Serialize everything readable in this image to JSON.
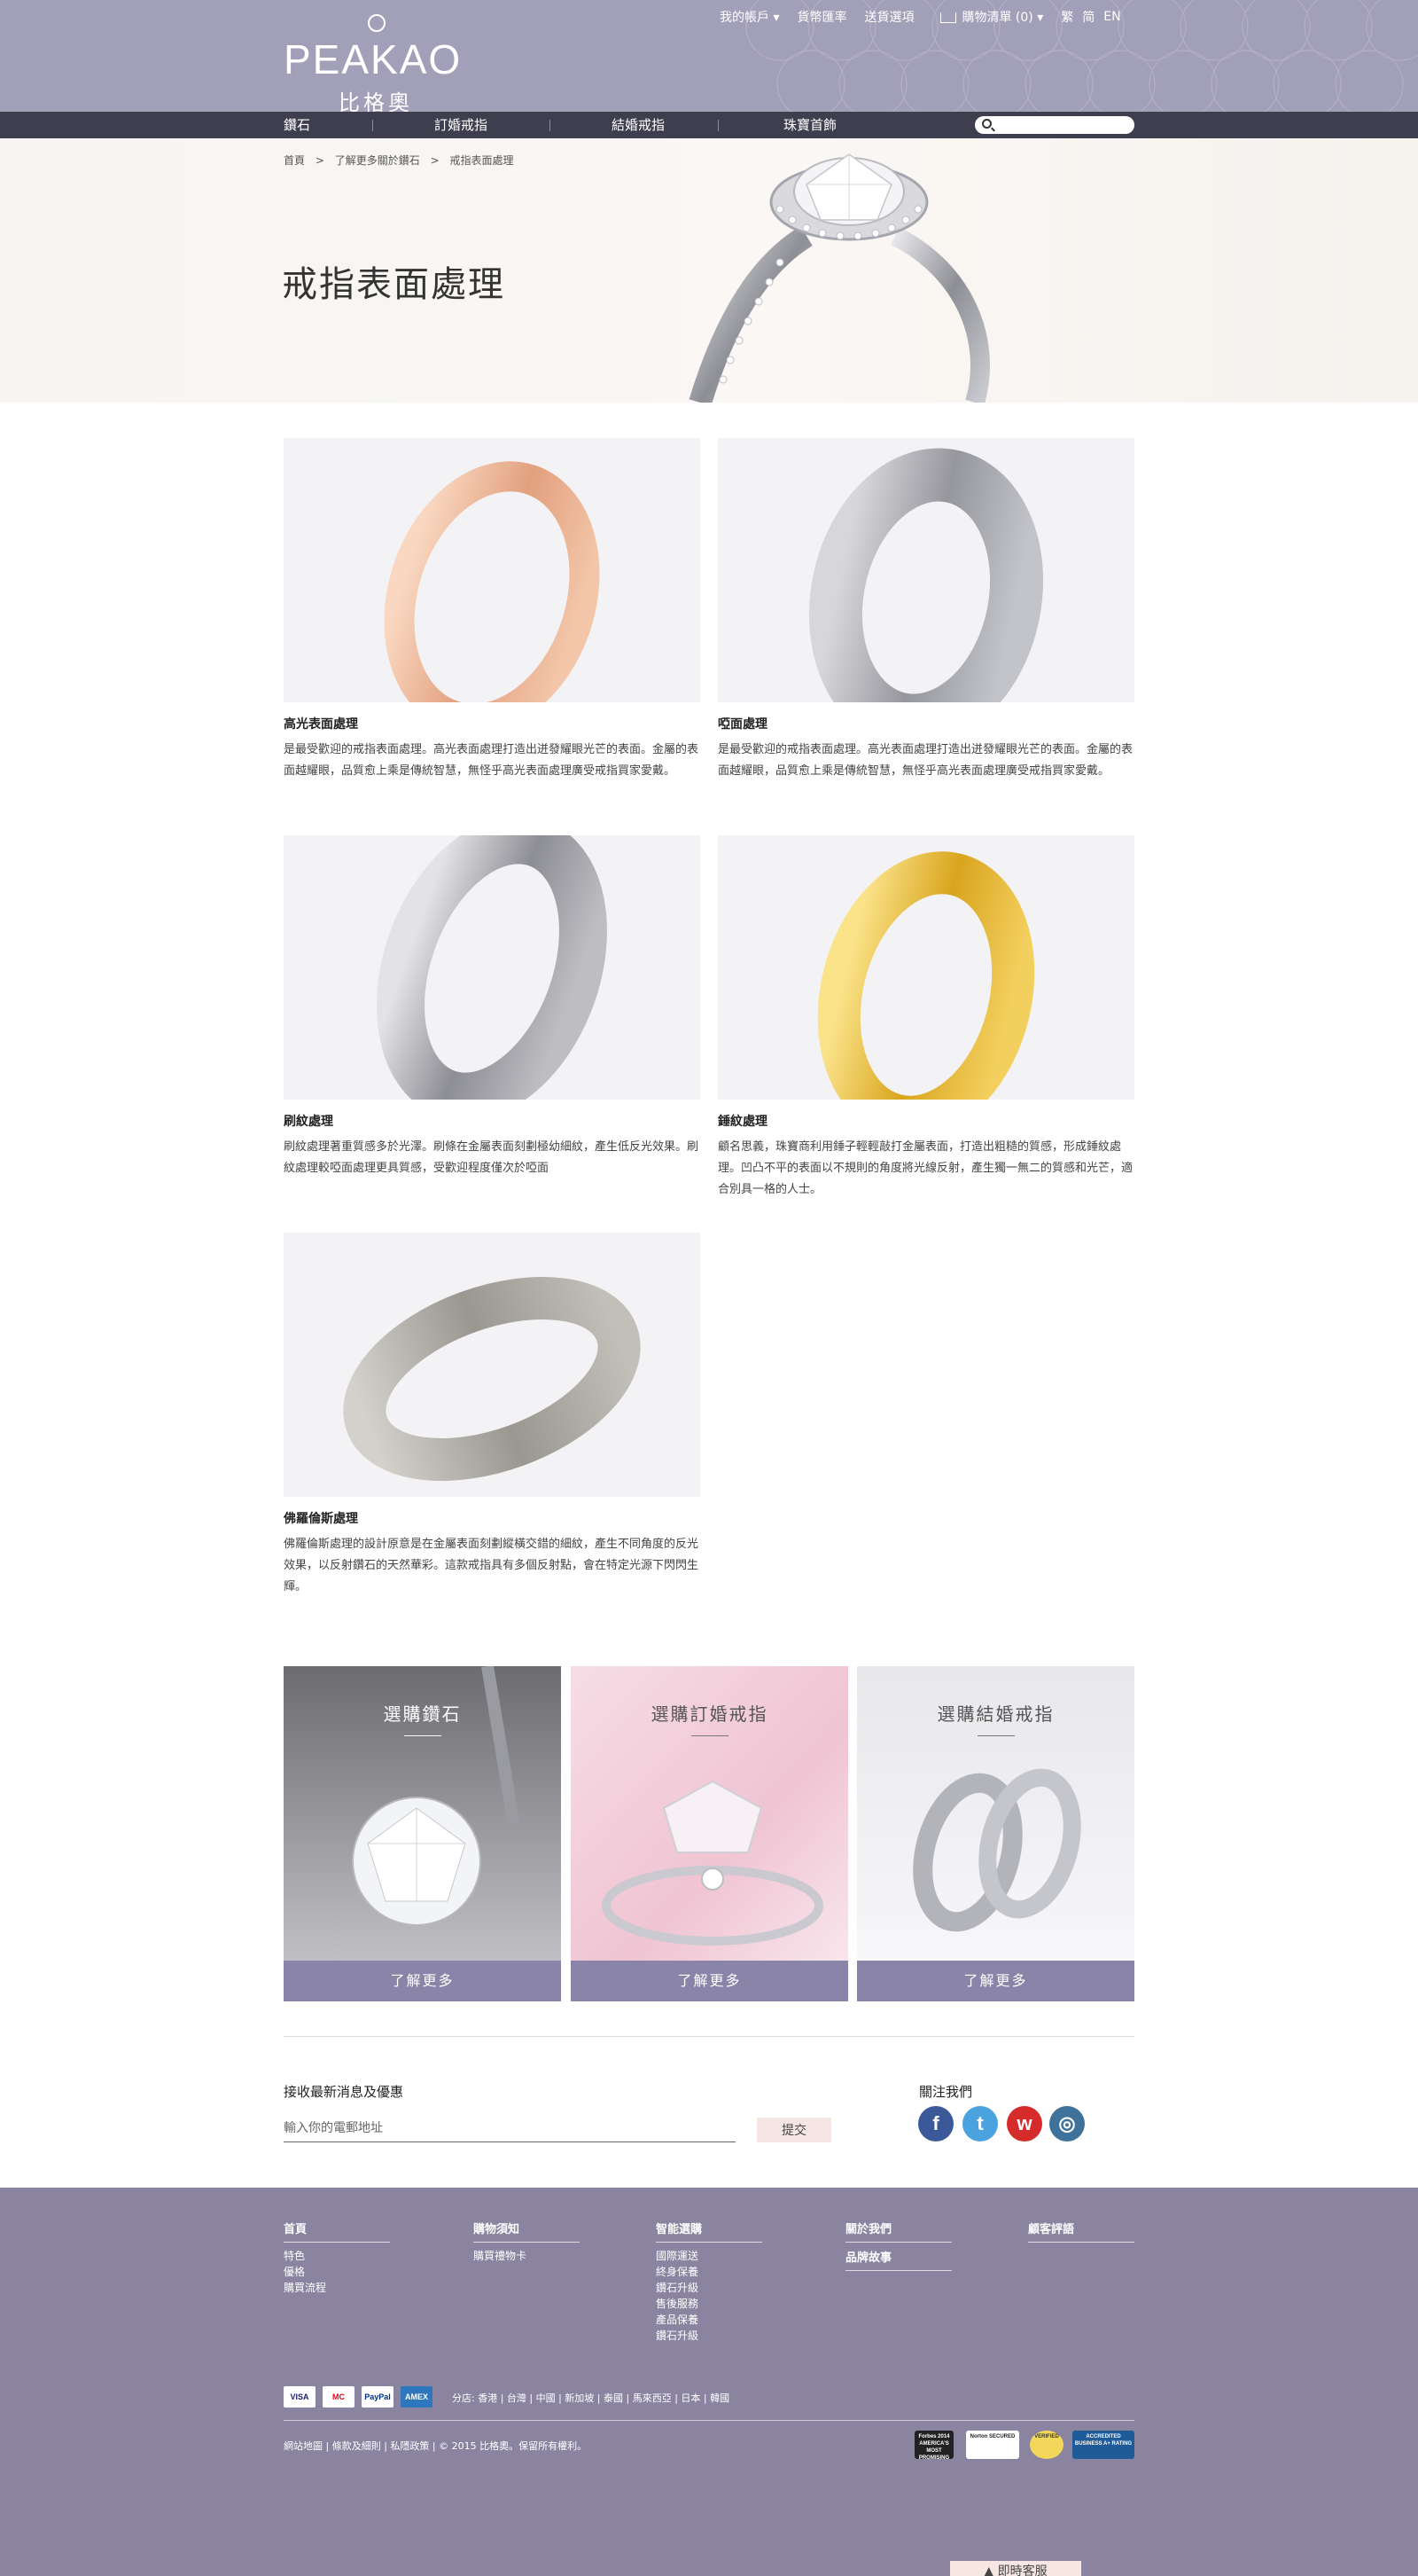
{
  "header": {
    "logo_text": "PEAKAO",
    "logo_cn": "比格奧",
    "utility": [
      "我的帳戶 ▾",
      "貨幣匯率",
      "送貨選項"
    ],
    "cart_label": "購物清單 (0) ▾",
    "lang_trad": "繁",
    "lang_simp": "简",
    "lang_en": "EN"
  },
  "nav": {
    "items": [
      "鑽石",
      "訂婚戒指",
      "結婚戒指",
      "珠寶首飾"
    ],
    "search_placeholder": ""
  },
  "breadcrumb": [
    "首頁",
    ">",
    "了解更多關於鑽石",
    ">",
    "戒指表面處理"
  ],
  "hero": {
    "title": "戒指表面處理"
  },
  "finishes": [
    {
      "title": "高光表面處理",
      "desc": "是最受歡迎的戒指表面處理。高光表面處理打造出迸發耀眼光芒的表面。金屬的表面越耀眼，品質愈上乘是傳統智慧，無怪乎高光表面處理廣受戒指買家愛戴。"
    },
    {
      "title": "啞面處理",
      "desc": "是最受歡迎的戒指表面處理。高光表面處理打造出迸發耀眼光芒的表面。金屬的表面越耀眼，品質愈上乘是傳統智慧，無怪乎高光表面處理廣受戒指買家愛戴。"
    },
    {
      "title": "刷紋處理",
      "desc": "刷紋處理著重質感多於光澤。刷條在金屬表面刻劃極幼細紋，產生低反光效果。刷紋處理較啞面處理更具質感，受歡迎程度僅次於啞面"
    },
    {
      "title": "錘紋處理",
      "desc": "顧名思義，珠寶商利用錘子輕輕敲打金屬表面，打造出粗糙的質感，形成錘紋處理。凹凸不平的表面以不規則的角度將光線反射，產生獨一無二的質感和光芒，適合別具一格的人士。"
    },
    {
      "title": "佛羅倫斯處理",
      "desc": "佛羅倫斯處理的設計原意是在金屬表面刻劃縱橫交錯的細紋，產生不同角度的反光效果，以反射鑽石的天然華彩。這款戒指具有多個反射點，會在特定光源下閃閃生輝。"
    }
  ],
  "promos": [
    {
      "title": "選購鑽石",
      "button": "了解更多"
    },
    {
      "title": "選購訂婚戒指",
      "button": "了解更多"
    },
    {
      "title": "選購結婚戒指",
      "button": "了解更多"
    }
  ],
  "newsletter": {
    "label": "接收最新消息及優惠",
    "placeholder": "輸入你的電郵地址",
    "submit": "提交"
  },
  "follow": {
    "label": "關注我們",
    "networks": [
      {
        "name": "facebook",
        "glyph": "f",
        "color": "#3b5998"
      },
      {
        "name": "twitter",
        "glyph": "t",
        "color": "#4aa3df"
      },
      {
        "name": "weibo",
        "glyph": "w",
        "color": "#d52b2b"
      },
      {
        "name": "instagram",
        "glyph": "◎",
        "color": "#3f729b"
      }
    ]
  },
  "footer": {
    "columns": [
      {
        "head": "首頁",
        "links": [
          "特色",
          "優格",
          "購買流程"
        ]
      },
      {
        "head": "購物須知",
        "links": [
          "購買禮物卡"
        ]
      },
      {
        "head": "智能選購",
        "links": [
          "國際運送",
          "終身保養",
          "鑽石升級",
          "售後服務",
          "產品保養",
          "鑽石升級"
        ]
      },
      {
        "head": "關於我們",
        "head2": "品牌故事",
        "links": []
      },
      {
        "head": "顧客評語",
        "links": []
      }
    ],
    "payments": [
      {
        "name": "visa",
        "label": "VISA",
        "bg": "#ffffff",
        "color": "#1a1f71"
      },
      {
        "name": "mastercard",
        "label": "MC",
        "bg": "#ffffff",
        "color": "#eb001b"
      },
      {
        "name": "paypal",
        "label": "PayPal",
        "bg": "#ffffff",
        "color": "#003087"
      },
      {
        "name": "amex",
        "label": "AMEX",
        "bg": "#2e77bc",
        "color": "#ffffff"
      }
    ],
    "branches": "分店: 香港 | 台灣 | 中國 | 新加坡 | 泰國 | 馬來西亞 | 日本 | 韓國",
    "legal": "網站地圖 | 條款及細則 | 私隱政策 | © 2015 比格奧。保留所有權利。",
    "trust": [
      {
        "name": "forbes-badge",
        "label": "Forbes 2014 AMERICA'S MOST PROMISING COMPANIES"
      },
      {
        "name": "norton-badge",
        "label": "Norton SECURED"
      },
      {
        "name": "verified-badge",
        "label": "VERIFIED"
      },
      {
        "name": "bbb-badge",
        "label": "ACCREDITED BUSINESS A+ RATING"
      }
    ],
    "live_chat": "▲ 即時客服"
  },
  "colors": {
    "header_bg": "#a29fb8",
    "nav_bg": "#3e3e4f",
    "footer_bg": "#8a84a0",
    "promo_button": "#8a84a8",
    "submit_bg": "#f5e6e3"
  }
}
